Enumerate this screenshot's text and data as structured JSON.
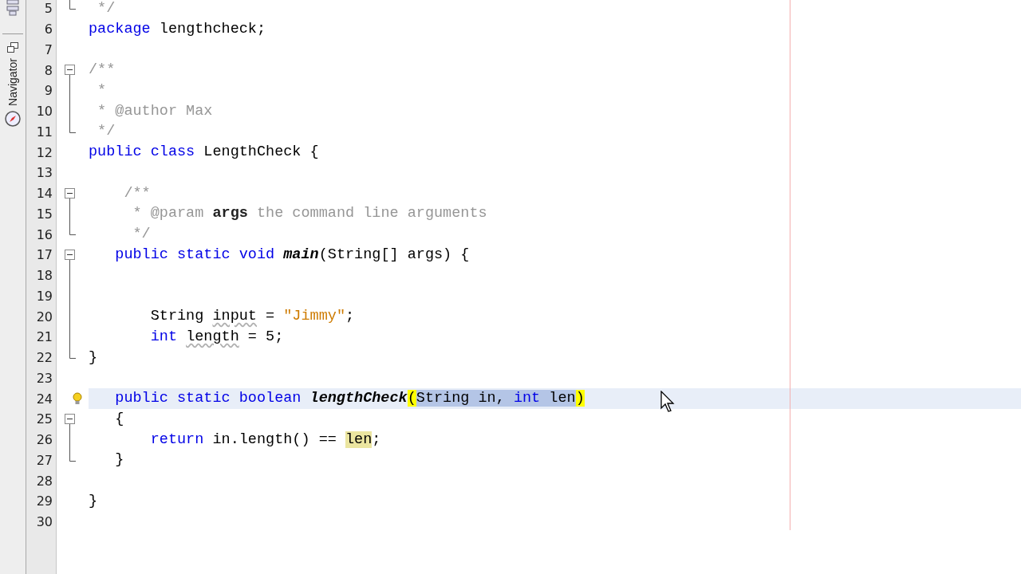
{
  "sidebar": {
    "tabs": [
      {
        "label": "Navigator",
        "selected": false
      }
    ]
  },
  "editor": {
    "lines": [
      {
        "number": "5",
        "kind": "fold-end",
        "tokens": [
          {
            "kind": "comment",
            "text": " */"
          }
        ]
      },
      {
        "number": "6",
        "kind": "plain",
        "tokens": [
          {
            "kind": "keyword",
            "text": "package "
          },
          {
            "kind": "plain",
            "text": "lengthcheck;"
          }
        ]
      },
      {
        "number": "7",
        "kind": "plain"
      },
      {
        "number": "8",
        "kind": "fold-start",
        "tokens": [
          {
            "kind": "comment",
            "text": "/**"
          }
        ]
      },
      {
        "number": "9",
        "kind": "fold-middle",
        "tokens": [
          {
            "kind": "comment",
            "text": " *"
          }
        ]
      },
      {
        "number": "10",
        "kind": "fold-middle",
        "tokens": [
          {
            "kind": "comment",
            "text": " * @author Max"
          }
        ]
      },
      {
        "number": "11",
        "kind": "fold-end",
        "tokens": [
          {
            "kind": "comment",
            "text": " */"
          }
        ]
      },
      {
        "number": "12",
        "kind": "plain",
        "tokens": [
          {
            "kind": "keyword",
            "text": "public class "
          },
          {
            "kind": "plain",
            "text": "LengthCheck {"
          }
        ]
      },
      {
        "number": "13",
        "kind": "plain"
      },
      {
        "number": "14",
        "kind": "fold-start",
        "tokens": [
          {
            "kind": "comment",
            "text": "    /**"
          }
        ]
      },
      {
        "number": "15",
        "kind": "fold-middle",
        "tokens": [
          {
            "kind": "comment",
            "text": "     * @param "
          },
          {
            "kind": "doc-param",
            "text": "args"
          },
          {
            "kind": "comment",
            "text": " the command line arguments"
          }
        ]
      },
      {
        "number": "16",
        "kind": "fold-end",
        "tokens": [
          {
            "kind": "comment",
            "text": "     */"
          }
        ]
      },
      {
        "number": "17",
        "kind": "fold-start",
        "tokens": [
          {
            "kind": "keyword",
            "text": "   public static void "
          },
          {
            "kind": "method",
            "text": "main"
          },
          {
            "kind": "plain",
            "text": "(String[] args) {"
          }
        ]
      },
      {
        "number": "18",
        "kind": "fold-middle"
      },
      {
        "number": "19",
        "kind": "fold-middle"
      },
      {
        "number": "20",
        "kind": "fold-middle",
        "tokens": [
          {
            "kind": "plain",
            "text": "       String "
          },
          {
            "kind": "plain",
            "text": "input",
            "warning": true
          },
          {
            "kind": "plain",
            "text": " = "
          },
          {
            "kind": "string",
            "text": "\"Jimmy\""
          },
          {
            "kind": "plain",
            "text": ";"
          }
        ]
      },
      {
        "number": "21",
        "kind": "fold-middle",
        "tokens": [
          {
            "kind": "keyword",
            "text": "       int "
          },
          {
            "kind": "plain",
            "text": "length",
            "warning": true
          },
          {
            "kind": "plain",
            "text": " = 5;"
          }
        ]
      },
      {
        "number": "22",
        "kind": "fold-end",
        "tokens": [
          {
            "kind": "plain",
            "text": "}"
          }
        ]
      },
      {
        "number": "23",
        "kind": "plain"
      },
      {
        "number": "24",
        "kind": "plain",
        "current": true,
        "hint": true,
        "tokens": [
          {
            "kind": "keyword",
            "text": "   public static boolean "
          },
          {
            "kind": "method",
            "text": "lengthCheck"
          },
          {
            "kind": "plain",
            "text": "(",
            "bracket_match": true
          },
          {
            "kind": "plain",
            "text": "String in, ",
            "selected": true
          },
          {
            "kind": "keyword",
            "text": "int",
            "selected": true
          },
          {
            "kind": "plain",
            "text": " len",
            "selected": true
          },
          {
            "kind": "plain",
            "text": ")",
            "bracket_match": true
          }
        ]
      },
      {
        "number": "25",
        "kind": "fold-start",
        "tokens": [
          {
            "kind": "plain",
            "text": "   {"
          }
        ]
      },
      {
        "number": "26",
        "kind": "fold-middle",
        "tokens": [
          {
            "kind": "keyword",
            "text": "       return "
          },
          {
            "kind": "plain",
            "text": "in.length() == "
          },
          {
            "kind": "plain",
            "text": "len",
            "occurrence": true
          },
          {
            "kind": "plain",
            "text": ";"
          }
        ]
      },
      {
        "number": "27",
        "kind": "fold-end",
        "tokens": [
          {
            "kind": "plain",
            "text": "   }"
          }
        ]
      },
      {
        "number": "28",
        "kind": "plain"
      },
      {
        "number": "29",
        "kind": "plain",
        "tokens": [
          {
            "kind": "plain",
            "text": "}"
          }
        ]
      },
      {
        "number": "30",
        "kind": "plain"
      }
    ]
  }
}
